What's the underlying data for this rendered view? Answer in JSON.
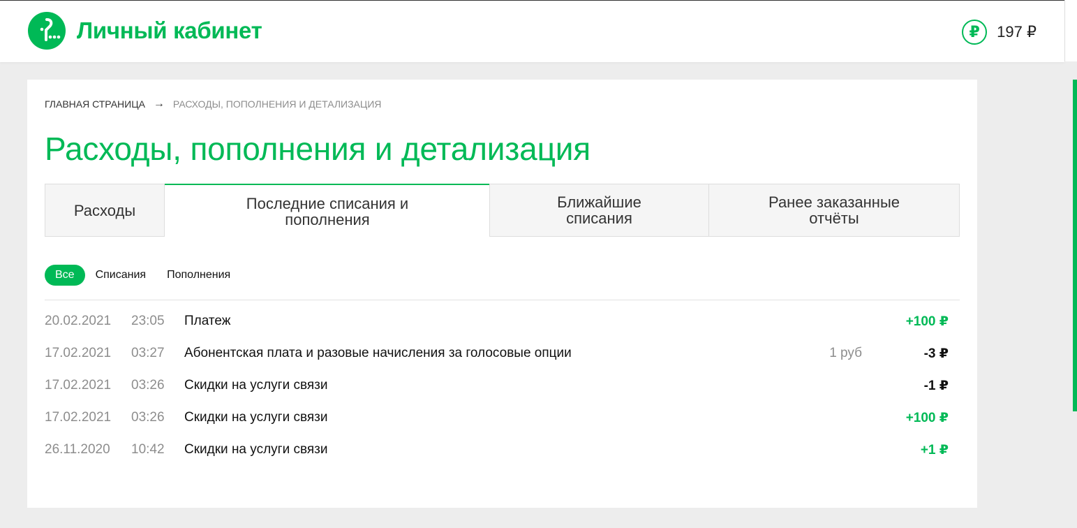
{
  "header": {
    "title": "Личный кабинет",
    "balance": "197 ₽",
    "currency_symbol": "₽",
    "brand_color": "#00b956",
    "logo_icon": "megafon-logo-icon"
  },
  "breadcrumb": {
    "home": "ГЛАВНАЯ СТРАНИЦА",
    "separator": "→",
    "current": "РАСХОДЫ, ПОПОЛНЕНИЯ И ДЕТАЛИЗАЦИЯ"
  },
  "page": {
    "title": "Расходы, пополнения и детализация"
  },
  "tabs": [
    {
      "line1": "Расходы",
      "line2": ""
    },
    {
      "line1": "Последние списания и",
      "line2": "пополнения"
    },
    {
      "line1": "Ближайшие",
      "line2": "списания"
    },
    {
      "line1": "Ранее заказанные",
      "line2": "отчёты"
    }
  ],
  "filters": {
    "all": "Все",
    "debits": "Списания",
    "credits": "Пополнения"
  },
  "transactions": [
    {
      "date": "20.02.2021",
      "time": "23:05",
      "description": "Платеж",
      "extra": "",
      "amount": "+100 ₽"
    },
    {
      "date": "17.02.2021",
      "time": "03:27",
      "description": "Абонентская плата и разовые начисления за голосовые опции",
      "extra": "1 руб",
      "amount": "-3 ₽"
    },
    {
      "date": "17.02.2021",
      "time": "03:26",
      "description": "Скидки на услуги связи",
      "extra": "",
      "amount": "-1 ₽"
    },
    {
      "date": "17.02.2021",
      "time": "03:26",
      "description": "Скидки на услуги связи",
      "extra": "",
      "amount": "+100 ₽"
    },
    {
      "date": "26.11.2020",
      "time": "10:42",
      "description": "Скидки на услуги связи",
      "extra": "",
      "amount": "+1 ₽"
    }
  ]
}
